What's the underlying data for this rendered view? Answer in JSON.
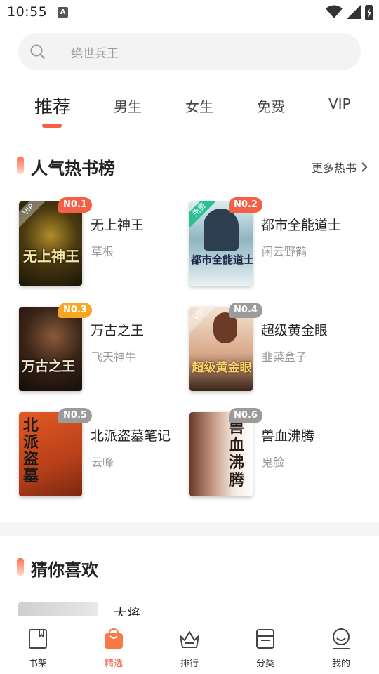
{
  "status_bar": {
    "time": "10:55",
    "notification_icon": "a-letter-icon"
  },
  "search": {
    "placeholder": "绝世兵王"
  },
  "tabs": [
    {
      "label": "推荐",
      "active": true
    },
    {
      "label": "男生"
    },
    {
      "label": "女生"
    },
    {
      "label": "免费"
    },
    {
      "label": "VIP"
    }
  ],
  "hot_section": {
    "title": "人气热书榜",
    "more_label": "更多热书"
  },
  "books": [
    {
      "rank": "N0.1",
      "title": "无上神王",
      "author": "草根",
      "tag": "VIP",
      "badge_color": "#f26045",
      "cover_text": "无上神王"
    },
    {
      "rank": "N0.2",
      "title": "都市全能道士",
      "author": "闲云野鹤",
      "tag": "免费",
      "badge_color": "#f26045",
      "cover_text": "都市全能道士"
    },
    {
      "rank": "N0.3",
      "title": "万古之王",
      "author": "飞天神牛",
      "tag": "",
      "badge_color": "#f5a623",
      "cover_text": "万古之王"
    },
    {
      "rank": "N0.4",
      "title": "超级黄金眼",
      "author": "韭菜盒子",
      "tag": "VIP",
      "badge_color": "#9b9b9b",
      "cover_text": "超级黄金眼"
    },
    {
      "rank": "N0.5",
      "title": "北派盗墓笔记",
      "author": "云峰",
      "tag": "",
      "badge_color": "#9b9b9b",
      "cover_text": "北派盗墓"
    },
    {
      "rank": "N0.6",
      "title": "兽血沸腾",
      "author": "鬼脸",
      "tag": "",
      "badge_color": "#9b9b9b",
      "cover_text": "兽血沸腾"
    }
  ],
  "guess_section": {
    "title": "猜你喜欢",
    "preview_title": "大将"
  },
  "bottom_nav": [
    {
      "label": "书架",
      "icon": "bookshelf-icon"
    },
    {
      "label": "精选",
      "icon": "shopping-bag-icon",
      "active": true
    },
    {
      "label": "排行",
      "icon": "crown-icon"
    },
    {
      "label": "分类",
      "icon": "category-icon"
    },
    {
      "label": "我的",
      "icon": "profile-icon"
    }
  ],
  "colors": {
    "accent": "#f26045",
    "badge_gold": "#f5a623",
    "badge_gray": "#9b9b9b"
  }
}
